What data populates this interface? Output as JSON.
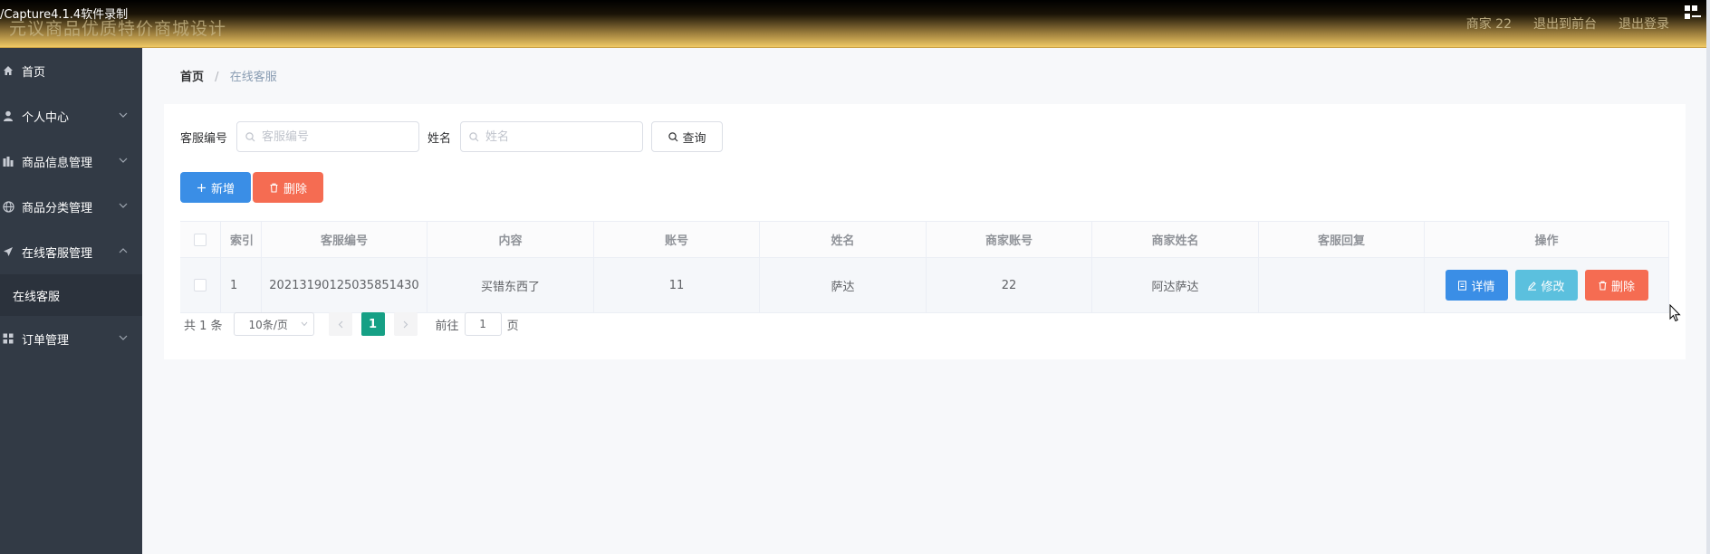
{
  "recorder_label": "/Capture4.1.4软件录制",
  "header": {
    "title": "元议商品优质特价商城设计",
    "user_label": "商家 22",
    "front_link": "退出到前台",
    "logout_link": "退出登录"
  },
  "sidebar": {
    "items": [
      {
        "label": "首页",
        "icon": "home-icon",
        "has_chevron": false
      },
      {
        "label": "个人中心",
        "icon": "user-icon",
        "has_chevron": true
      },
      {
        "label": "商品信息管理",
        "icon": "chart-icon",
        "has_chevron": true
      },
      {
        "label": "商品分类管理",
        "icon": "globe-icon",
        "has_chevron": true
      },
      {
        "label": "在线客服管理",
        "icon": "send-icon",
        "has_chevron": true,
        "expanded": true
      },
      {
        "label": "订单管理",
        "icon": "grid-icon",
        "has_chevron": true
      }
    ],
    "sub_item": "在线客服"
  },
  "breadcrumb": {
    "home": "首页",
    "separator": "/",
    "current": "在线客服"
  },
  "search": {
    "field1_label": "客服编号",
    "field1_placeholder": "客服编号",
    "field2_label": "姓名",
    "field2_placeholder": "姓名",
    "query_button": "查询"
  },
  "actions": {
    "add_button": "新增",
    "delete_button": "删除"
  },
  "table": {
    "columns": [
      "索引",
      "客服编号",
      "内容",
      "账号",
      "姓名",
      "商家账号",
      "商家姓名",
      "客服回复",
      "操作"
    ],
    "rows": [
      {
        "index": "1",
        "service_no": "20213190125035851430",
        "content": "买错东西了",
        "account": "11",
        "name": "萨达",
        "merchant_account": "22",
        "merchant_name": "阿达萨达",
        "reply": ""
      }
    ],
    "row_actions": {
      "detail": "详情",
      "edit": "修改",
      "delete": "删除"
    }
  },
  "pagination": {
    "total_text": "共 1 条",
    "page_size": "10条/页",
    "current_page": "1",
    "goto_label": "前往",
    "goto_value": "1",
    "page_suffix": "页"
  },
  "colors": {
    "primary": "#3a8ee6",
    "danger": "#f56c52",
    "info": "#5bc0de",
    "pager_active": "#16a085",
    "sidebar": "#323a45"
  }
}
